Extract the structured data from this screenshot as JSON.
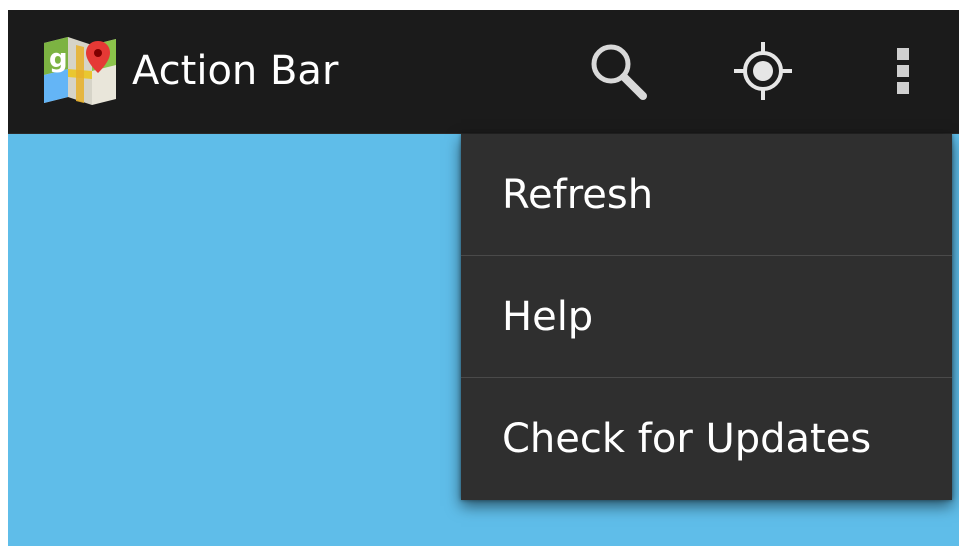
{
  "action_bar": {
    "title": "Action Bar",
    "app_icon": "google-maps-icon",
    "actions": {
      "search": {
        "icon": "search-icon"
      },
      "locate": {
        "icon": "my-location-icon"
      },
      "overflow": {
        "icon": "overflow-menu-icon"
      }
    },
    "background_color": "#1b1b1b"
  },
  "overflow_menu": {
    "items": [
      {
        "label": "Refresh"
      },
      {
        "label": "Help"
      },
      {
        "label": "Check for Updates"
      }
    ],
    "background_color": "#2f2f2f"
  },
  "content": {
    "background_color": "#5fbde9"
  }
}
